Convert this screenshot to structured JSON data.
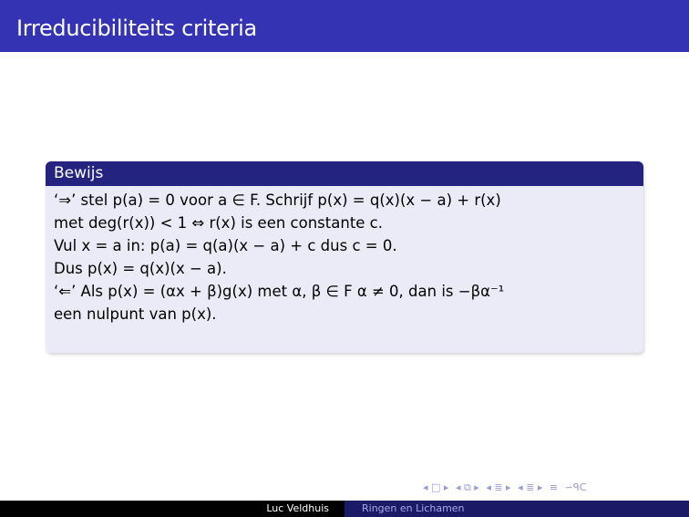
{
  "slide": {
    "title": "Irreducibiliteits criteria"
  },
  "block": {
    "title": "Bewijs",
    "lines": [
      "‘⇒’ stel p(a) = 0 voor a ∈ F. Schrijf p(x) = q(x)(x − a) + r(x)",
      "met deg(r(x)) < 1 ⇔ r(x) is een constante c.",
      "Vul x = a in: p(a) = q(a)(x − a) + c dus c = 0.",
      "Dus p(x) = q(x)(x − a).",
      "‘⇐’ Als p(x) = (αx + β)g(x) met α, β ∈ F α ≠ 0, dan is −βα⁻¹",
      "een nulpunt van p(x)."
    ]
  },
  "navigation": {
    "icons": [
      "◂ □ ▸",
      "◂ ⧉ ▸",
      "◂ ≣ ▸",
      "◂ ≣ ▸",
      "≡",
      "∽ᑫᑕ"
    ]
  },
  "footer": {
    "author": "Luc Veldhuis",
    "course": "Ringen en Lichamen"
  },
  "colors": {
    "header_bg": "#3333b3",
    "block_title_bg": "#242480",
    "block_body_bg": "#ebebf7",
    "footer_left_bg": "#000000",
    "footer_right_bg": "#1a1a66"
  }
}
